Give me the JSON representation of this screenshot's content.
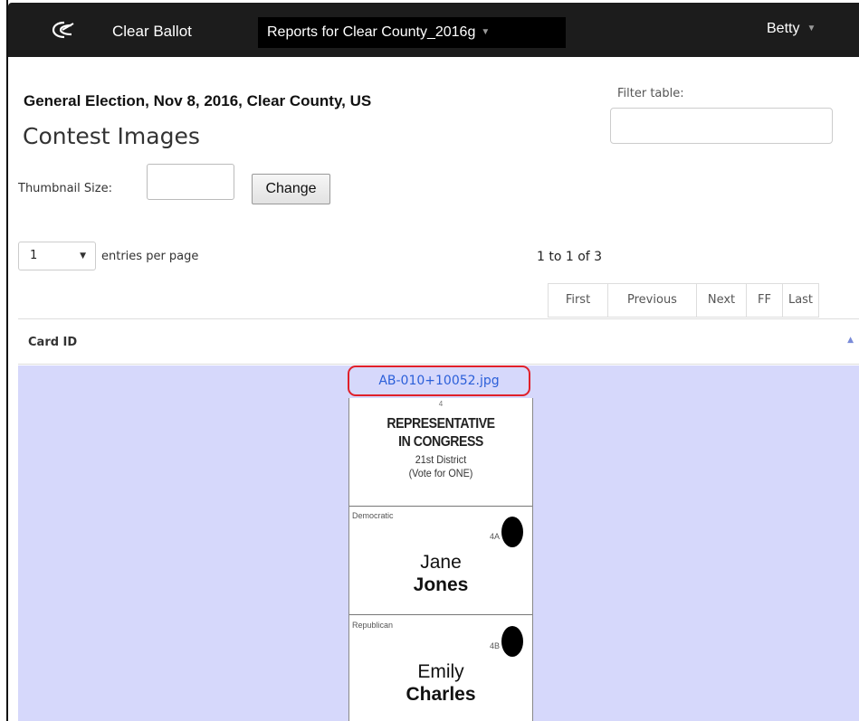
{
  "navbar": {
    "brand": "Clear Ballot",
    "reports_menu": "Reports for Clear County_2016g",
    "user": "Betty"
  },
  "page": {
    "election_title": "General Election, Nov 8, 2016, Clear County, US",
    "title": "Contest Images"
  },
  "filter": {
    "label": "Filter table:",
    "value": ""
  },
  "thumbnail": {
    "label": "Thumbnail Size:",
    "value": "",
    "change_label": "Change"
  },
  "entries": {
    "selected": "1",
    "label": "entries per page"
  },
  "pagination": {
    "range": "1 to 1 of 3",
    "first": "First",
    "previous": "Previous",
    "next": "Next",
    "ff": "FF",
    "last": "Last"
  },
  "table": {
    "column_header": "Card ID",
    "rows": [
      {
        "file": "AB-010+10052.jpg",
        "ballot": {
          "contest_number": "4",
          "title_line1": "REPRESENTATIVE",
          "title_line2": "IN CONGRESS",
          "district": "21st District",
          "instruction": "(Vote for ONE)",
          "candidates": [
            {
              "party": "Democratic",
              "code": "4A",
              "first": "Jane",
              "last": "Jones"
            },
            {
              "party": "Republican",
              "code": "4B",
              "first": "Emily",
              "last": "Charles"
            }
          ]
        }
      }
    ]
  },
  "icons": {
    "logo": "clear-ballot-logo-icon",
    "caret": "caret-down-icon",
    "sort": "sort-asc-icon"
  }
}
